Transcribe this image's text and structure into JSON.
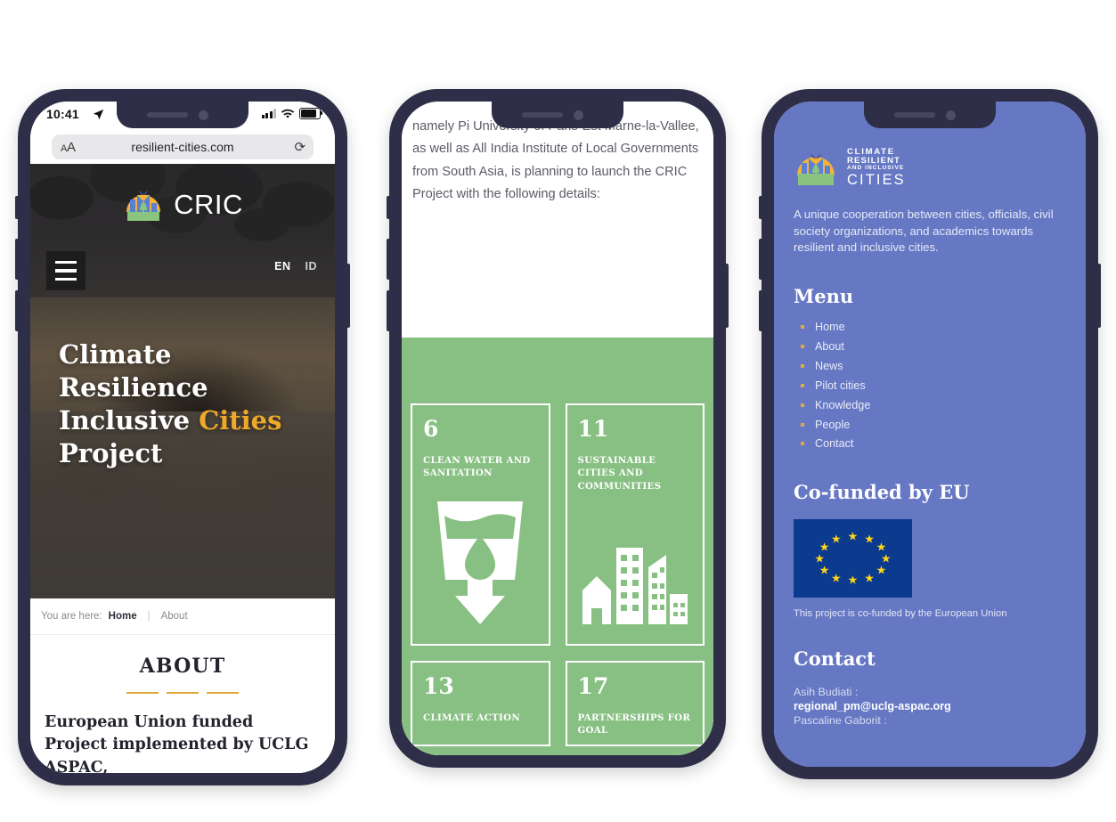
{
  "phone1": {
    "status": {
      "time": "10:41",
      "location_icon": "location-arrow-icon",
      "wifi_icon": "wifi-icon",
      "signal_icon": "cellular-signal-icon",
      "battery_icon": "battery-icon"
    },
    "browser": {
      "text_size_label": "AA",
      "url": "resilient-cities.com",
      "reload_icon": "reload-icon"
    },
    "header": {
      "brand": "CRIC",
      "logo_icon": "cric-logo-icon",
      "menu_icon": "hamburger-menu-icon",
      "lang_active": "EN",
      "lang_other": "ID"
    },
    "hero": {
      "line1": "Climate",
      "line2": "Resilience",
      "line3a": "Inclusive",
      "line3b": "Cities",
      "line4": "Project",
      "accent_color": "#f0a82a"
    },
    "breadcrumb": {
      "label": "You are here:",
      "home": "Home",
      "separator": "|",
      "current": "About"
    },
    "about": {
      "title": "ABOUT",
      "paragraph": "European Union funded Project implemented by UCLG ASPAC,"
    }
  },
  "phone2": {
    "paragraph": "namely Pi  University of Paris-Est Marne-la-Vallee, as well as All India Institute of Local Governments from South Asia, is planning to launch the CRIC Project with the following details:",
    "green_bg": "#87c082",
    "sdg_cards": [
      {
        "number": "6",
        "label": "CLEAN WATER AND SANITATION",
        "icon": "water-glass-drop-icon"
      },
      {
        "number": "11",
        "label": "SUSTAINABLE CITIES AND COMMUNITIES",
        "icon": "city-buildings-icon"
      },
      {
        "number": "13",
        "label": "CLIMATE ACTION",
        "icon": "climate-action-icon"
      },
      {
        "number": "17",
        "label": "PARTNERSHIPS FOR GOAL",
        "icon": "partnerships-icon"
      }
    ]
  },
  "phone3": {
    "bg_color": "#6678c4",
    "logo": {
      "icon": "cric-logo-icon",
      "line1": "CLIMATE",
      "line2": "RESILIENT",
      "line3": "AND INCLUSIVE",
      "line4": "CITIES"
    },
    "intro": "A unique cooperation between cities, officials, civil society organizations, and academics towards resilient and inclusive cities.",
    "menu": {
      "title": "Menu",
      "items": [
        "Home",
        "About",
        "News",
        "Pilot cities",
        "Knowledge",
        "People",
        "Contact"
      ],
      "bullet_color": "#e4a93c"
    },
    "eu": {
      "title": "Co-funded by EU",
      "flag_icon": "eu-flag-icon",
      "note": "This project is co-funded by the European Union"
    },
    "contact": {
      "title": "Contact",
      "entries": [
        {
          "name": "Asih Budiati :",
          "email": "regional_pm@uclg-aspac.org"
        },
        {
          "name": "Pascaline Gaborit :",
          "email": ""
        }
      ]
    }
  }
}
